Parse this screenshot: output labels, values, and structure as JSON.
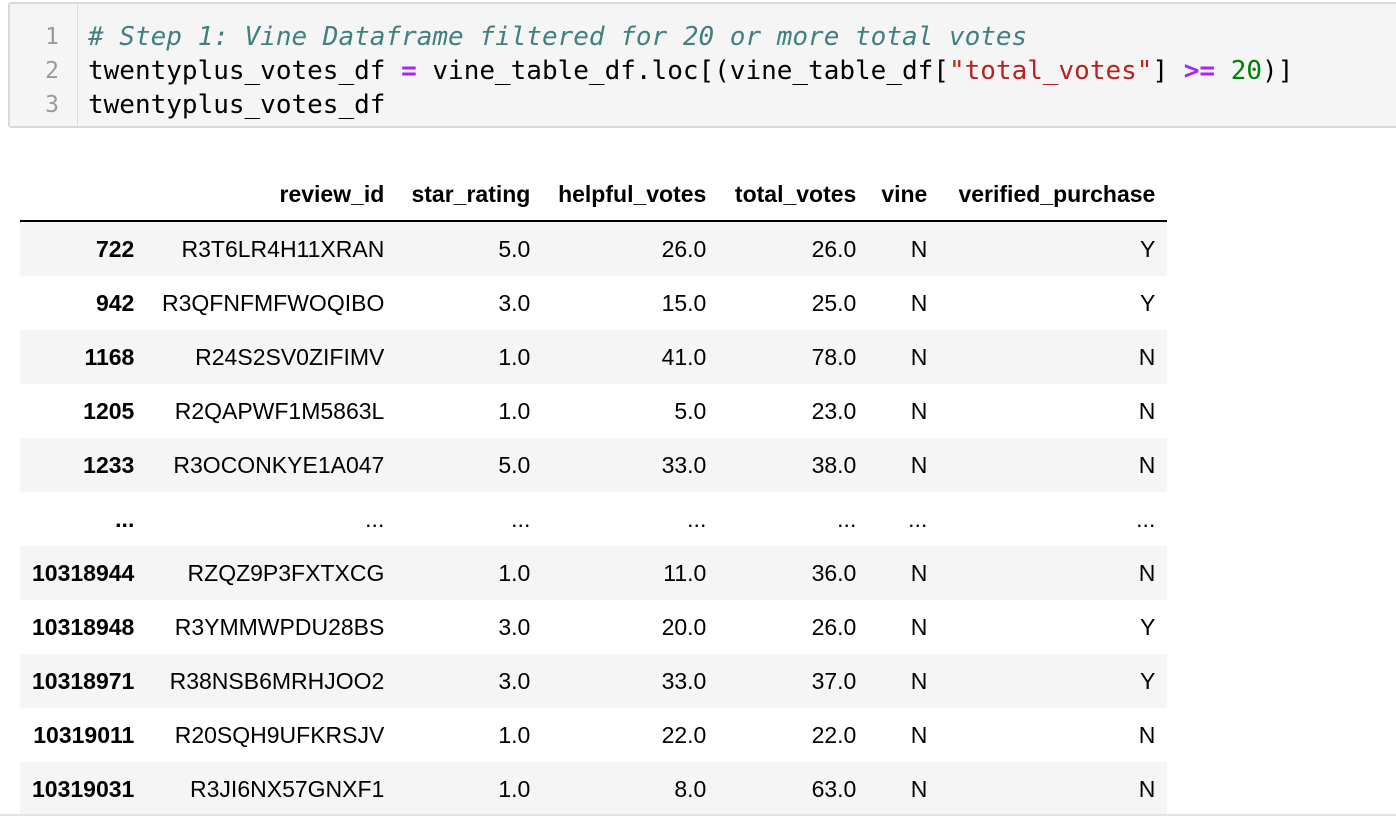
{
  "code_cell": {
    "line_numbers": [
      "1",
      "2",
      "3"
    ],
    "line1": {
      "comment": "# Step 1: Vine Dataframe filtered for 20 or more total votes"
    },
    "line2": {
      "var": "twentyplus_votes_df ",
      "assign": "=",
      "expr_a": " vine_table_df.loc[(vine_table_df[",
      "string": "\"total_votes\"",
      "expr_b": "] ",
      "op": ">=",
      "space": " ",
      "number": "20",
      "expr_c": ")]"
    },
    "line3": {
      "text": "twentyplus_votes_df"
    }
  },
  "table": {
    "columns": [
      "review_id",
      "star_rating",
      "helpful_votes",
      "total_votes",
      "vine",
      "verified_purchase"
    ],
    "rows": [
      {
        "index": "722",
        "review_id": "R3T6LR4H11XRAN",
        "star_rating": "5.0",
        "helpful_votes": "26.0",
        "total_votes": "26.0",
        "vine": "N",
        "verified_purchase": "Y"
      },
      {
        "index": "942",
        "review_id": "R3QFNFMFWOQIBO",
        "star_rating": "3.0",
        "helpful_votes": "15.0",
        "total_votes": "25.0",
        "vine": "N",
        "verified_purchase": "Y"
      },
      {
        "index": "1168",
        "review_id": "R24S2SV0ZIFIMV",
        "star_rating": "1.0",
        "helpful_votes": "41.0",
        "total_votes": "78.0",
        "vine": "N",
        "verified_purchase": "N"
      },
      {
        "index": "1205",
        "review_id": "R2QAPWF1M5863L",
        "star_rating": "1.0",
        "helpful_votes": "5.0",
        "total_votes": "23.0",
        "vine": "N",
        "verified_purchase": "N"
      },
      {
        "index": "1233",
        "review_id": "R3OCONKYE1A047",
        "star_rating": "5.0",
        "helpful_votes": "33.0",
        "total_votes": "38.0",
        "vine": "N",
        "verified_purchase": "N"
      },
      {
        "index": "...",
        "review_id": "...",
        "star_rating": "...",
        "helpful_votes": "...",
        "total_votes": "...",
        "vine": "...",
        "verified_purchase": "..."
      },
      {
        "index": "10318944",
        "review_id": "RZQZ9P3FXTXCG",
        "star_rating": "1.0",
        "helpful_votes": "11.0",
        "total_votes": "36.0",
        "vine": "N",
        "verified_purchase": "N"
      },
      {
        "index": "10318948",
        "review_id": "R3YMMWPDU28BS",
        "star_rating": "3.0",
        "helpful_votes": "20.0",
        "total_votes": "26.0",
        "vine": "N",
        "verified_purchase": "Y"
      },
      {
        "index": "10318971",
        "review_id": "R38NSB6MRHJOO2",
        "star_rating": "3.0",
        "helpful_votes": "33.0",
        "total_votes": "37.0",
        "vine": "N",
        "verified_purchase": "Y"
      },
      {
        "index": "10319011",
        "review_id": "R20SQH9UFKRSJV",
        "star_rating": "1.0",
        "helpful_votes": "22.0",
        "total_votes": "22.0",
        "vine": "N",
        "verified_purchase": "N"
      },
      {
        "index": "10319031",
        "review_id": "R3JI6NX57GNXF1",
        "star_rating": "1.0",
        "helpful_votes": "8.0",
        "total_votes": "63.0",
        "vine": "N",
        "verified_purchase": "N"
      }
    ]
  }
}
